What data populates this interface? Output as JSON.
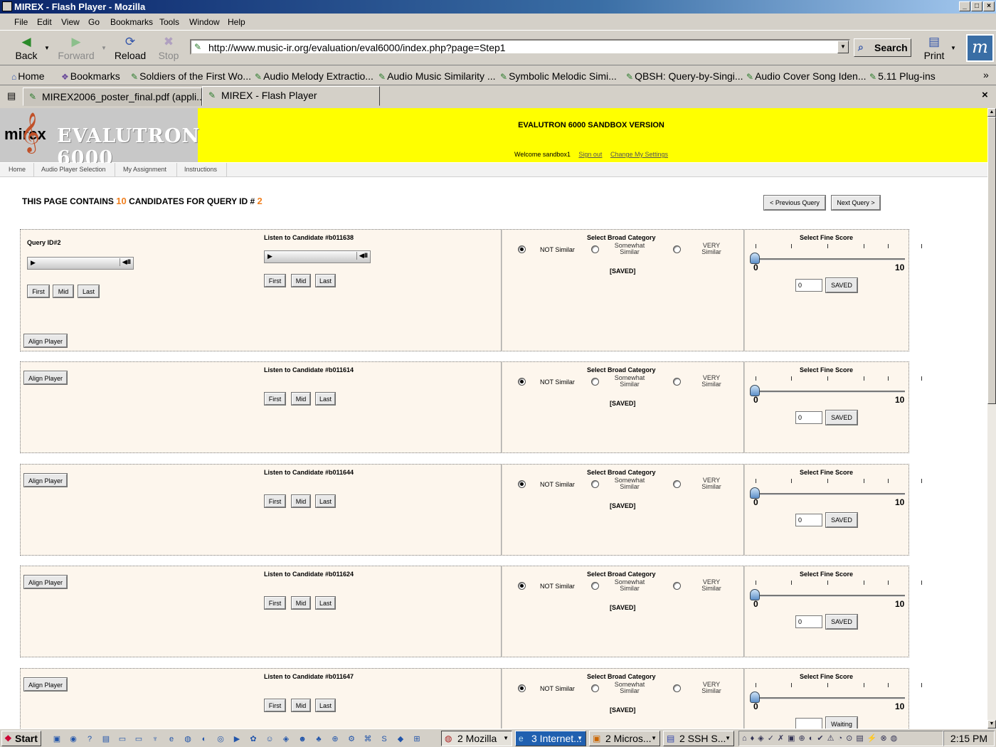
{
  "window": {
    "title": "MIREX - Flash Player - Mozilla",
    "min": "_",
    "max": "□",
    "close": "×"
  },
  "menu": [
    "File",
    "Edit",
    "View",
    "Go",
    "Bookmarks",
    "Tools",
    "Window",
    "Help"
  ],
  "nav": {
    "back": "Back",
    "forward": "Forward",
    "reload": "Reload",
    "stop": "Stop",
    "print": "Print",
    "search": "Search"
  },
  "url": "http://www.music-ir.org/evaluation/eval6000/index.php?page=Step1",
  "bookmarks": [
    "Home",
    "Bookmarks",
    "Soldiers of the First Wo...",
    "Audio Melody Extractio...",
    "Audio Music Similarity ...",
    "Symbolic Melodic Simi...",
    "QBSH: Query-by-Singi...",
    "Audio Cover Song Iden...",
    "5.11 Plug-ins"
  ],
  "tabs": [
    "MIREX2006_poster_final.pdf (appli...",
    "MIREX - Flash Player"
  ],
  "site": {
    "logo_left": "mirex",
    "logo_right": "EVALUTRON 6000",
    "banner_title": "EVALUTRON 6000 SANDBOX VERSION",
    "welcome": "Welcome sandbox1",
    "signout": "Sign out",
    "settings": "Change My Settings",
    "subnav": [
      "Home",
      "Audio Player Selection",
      "My Assignment",
      "Instructions"
    ],
    "info_pre": "THIS PAGE CONTAINS",
    "info_count": "10",
    "info_mid": "CANDIDATES FOR QUERY ID #",
    "info_id": "2",
    "prev": "< Previous Query",
    "next": "Next Query >"
  },
  "labels": {
    "query": "Query ID#2",
    "first": "First",
    "mid": "Mid",
    "last": "Last",
    "align": "Align Player",
    "broad": "Select Broad Category",
    "fine": "Select Fine Score",
    "not": "NOT Similar",
    "some1": "Somewhat",
    "some2": "Similar",
    "very1": "VERY",
    "very2": "Similar",
    "min": "0",
    "max": "10"
  },
  "candidates": [
    {
      "label": "Listen to Candidate #b011638",
      "status": "[SAVED]",
      "score": "0",
      "save": "SAVED",
      "selected": "not",
      "fine": 0
    },
    {
      "label": "Listen to Candidate #b011614",
      "status": "[SAVED]",
      "score": "0",
      "save": "SAVED",
      "selected": "not",
      "fine": 0
    },
    {
      "label": "Listen to Candidate #b011644",
      "status": "[SAVED]",
      "score": "0",
      "save": "SAVED",
      "selected": "not",
      "fine": 0
    },
    {
      "label": "Listen to Candidate #b011624",
      "status": "[SAVED]",
      "score": "0",
      "save": "SAVED",
      "selected": "not",
      "fine": 0
    },
    {
      "label": "Listen to Candidate #b011647",
      "status": "[SAVED]",
      "score": "",
      "save": "Waiting",
      "selected": "not",
      "fine": 0
    }
  ],
  "taskbar": {
    "start": "Start",
    "items": [
      "2 Mozilla",
      "3 Internet...",
      "2 Micros...",
      "2 SSH S..."
    ],
    "clock": "2:15 PM"
  }
}
